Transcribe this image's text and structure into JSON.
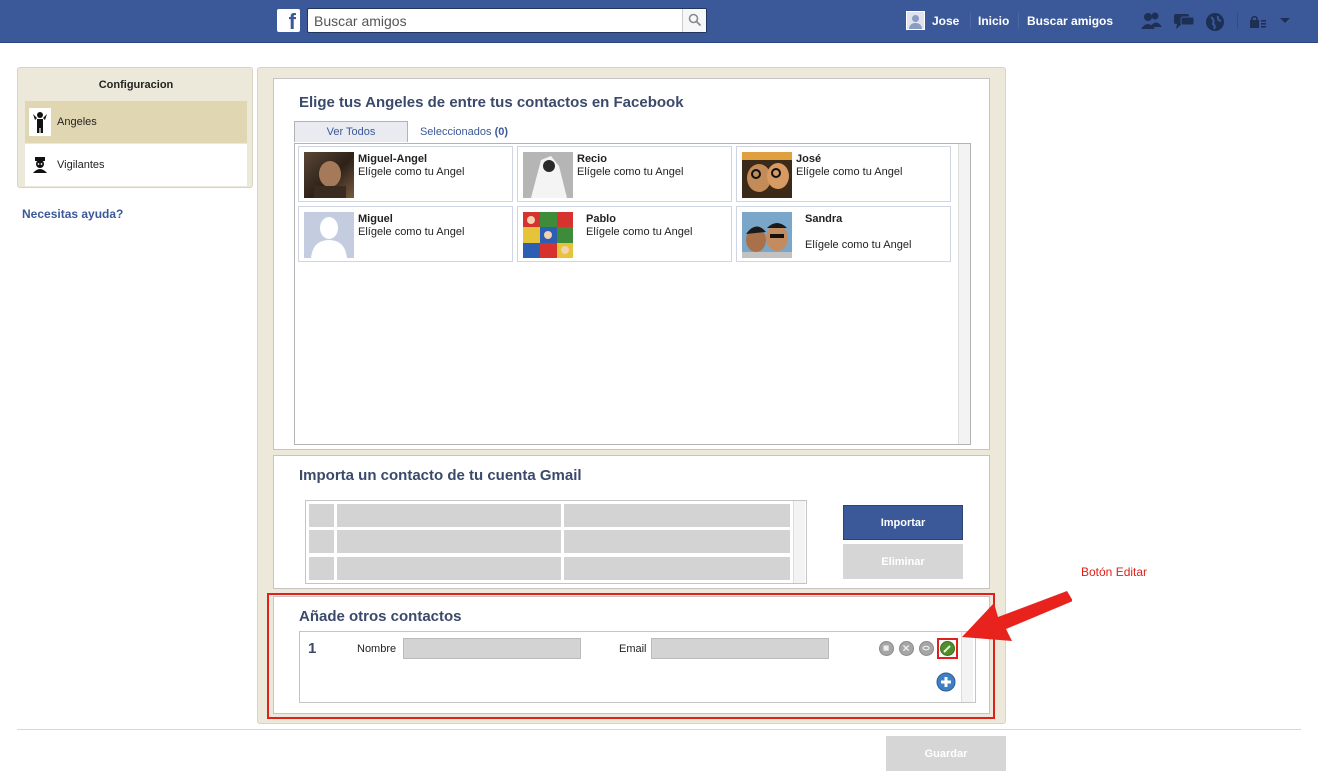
{
  "topbar": {
    "search_placeholder": "Buscar amigos",
    "user_name": "Jose",
    "nav_home": "Inicio",
    "nav_find_friends": "Buscar amigos",
    "brand_color": "#3b5998"
  },
  "sidebar": {
    "title": "Configuracion",
    "items": [
      {
        "label": "Angeles",
        "active": true
      },
      {
        "label": "Vigilantes",
        "active": false
      }
    ],
    "help_link": "Necesitas ayuda?"
  },
  "angels_section": {
    "title": "Elige tus Angeles de entre tus contactos en Facebook",
    "tab_all": "Ver Todos",
    "tab_selected_label": "Seleccionados",
    "tab_selected_count": "(0)",
    "friends": [
      {
        "name": "Miguel-Angel",
        "action": "Elígele como tu Angel"
      },
      {
        "name": "Recio",
        "action": "Elígele como tu Angel"
      },
      {
        "name": "José",
        "action": "Elígele como tu Angel"
      },
      {
        "name": "Miguel",
        "action": "Elígele como tu Angel"
      },
      {
        "name": "Pablo",
        "action": "Elígele como tu Angel"
      },
      {
        "name": "Sandra",
        "action": "Elígele como tu Angel"
      }
    ]
  },
  "gmail_section": {
    "title": "Importa un contacto de tu cuenta Gmail",
    "import_button": "Importar",
    "delete_button": "Eliminar"
  },
  "other_contacts": {
    "title": "Añade otros contactos",
    "row_number": "1",
    "name_label": "Nombre",
    "email_label": "Email"
  },
  "annotation": {
    "label": "Botón Editar",
    "color": "#e0201b"
  },
  "footer": {
    "save_button": "Guardar"
  }
}
